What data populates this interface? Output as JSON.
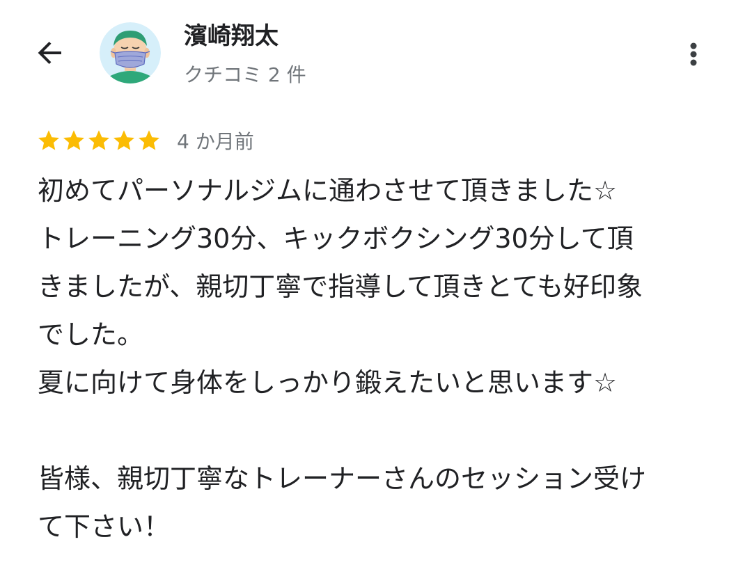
{
  "header": {
    "back_icon": "arrow-left-icon",
    "reviewer_name": "濱崎翔太",
    "review_count": "クチコミ 2 件",
    "avatar_icon": "masked-person-avatar",
    "more_icon": "more-vert-icon"
  },
  "review": {
    "rating": 5,
    "rating_max": 5,
    "star_color": "#fbbc04",
    "date": "4 か月前",
    "lines": [
      "初めてパーソナルジムに通わさせて頂きました☆",
      "トレーニング30分、キックボクシング30分して頂",
      "きましたが、親切丁寧で指導して頂きとても好印象",
      "でした。",
      "夏に向けて身体をしっかり鍛えたいと思います☆",
      "",
      "皆様、親切丁寧なトレーナーさんのセッション受け",
      "て下さい！"
    ]
  },
  "colors": {
    "text_primary": "#202124",
    "text_secondary": "#70757a",
    "avatar_bg": "#d6effa",
    "avatar_shirt": "#2ea87a",
    "avatar_mask": "#9fa8da"
  }
}
